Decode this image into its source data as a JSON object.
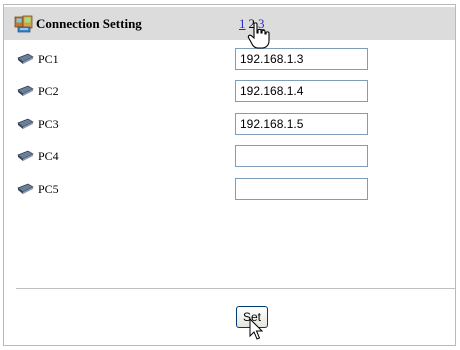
{
  "header": {
    "title": "Connection Setting",
    "title_icon": "network-computers-icon",
    "pages": [
      {
        "label": "1",
        "current": false
      },
      {
        "label": "2",
        "current": true
      },
      {
        "label": "3",
        "current": false
      }
    ]
  },
  "rows": [
    {
      "label": "PC1",
      "icon": "laptop-icon",
      "value": "192.168.1.3"
    },
    {
      "label": "PC2",
      "icon": "laptop-icon",
      "value": "192.168.1.4"
    },
    {
      "label": "PC3",
      "icon": "laptop-icon",
      "value": "192.168.1.5"
    },
    {
      "label": "PC4",
      "icon": "laptop-icon",
      "value": ""
    },
    {
      "label": "PC5",
      "icon": "laptop-icon",
      "value": ""
    }
  ],
  "set_button": {
    "label": "Set"
  },
  "colors": {
    "header_bg": "#dcdcdc",
    "link": "#2a2ad0",
    "input_border": "#7f9db9"
  }
}
